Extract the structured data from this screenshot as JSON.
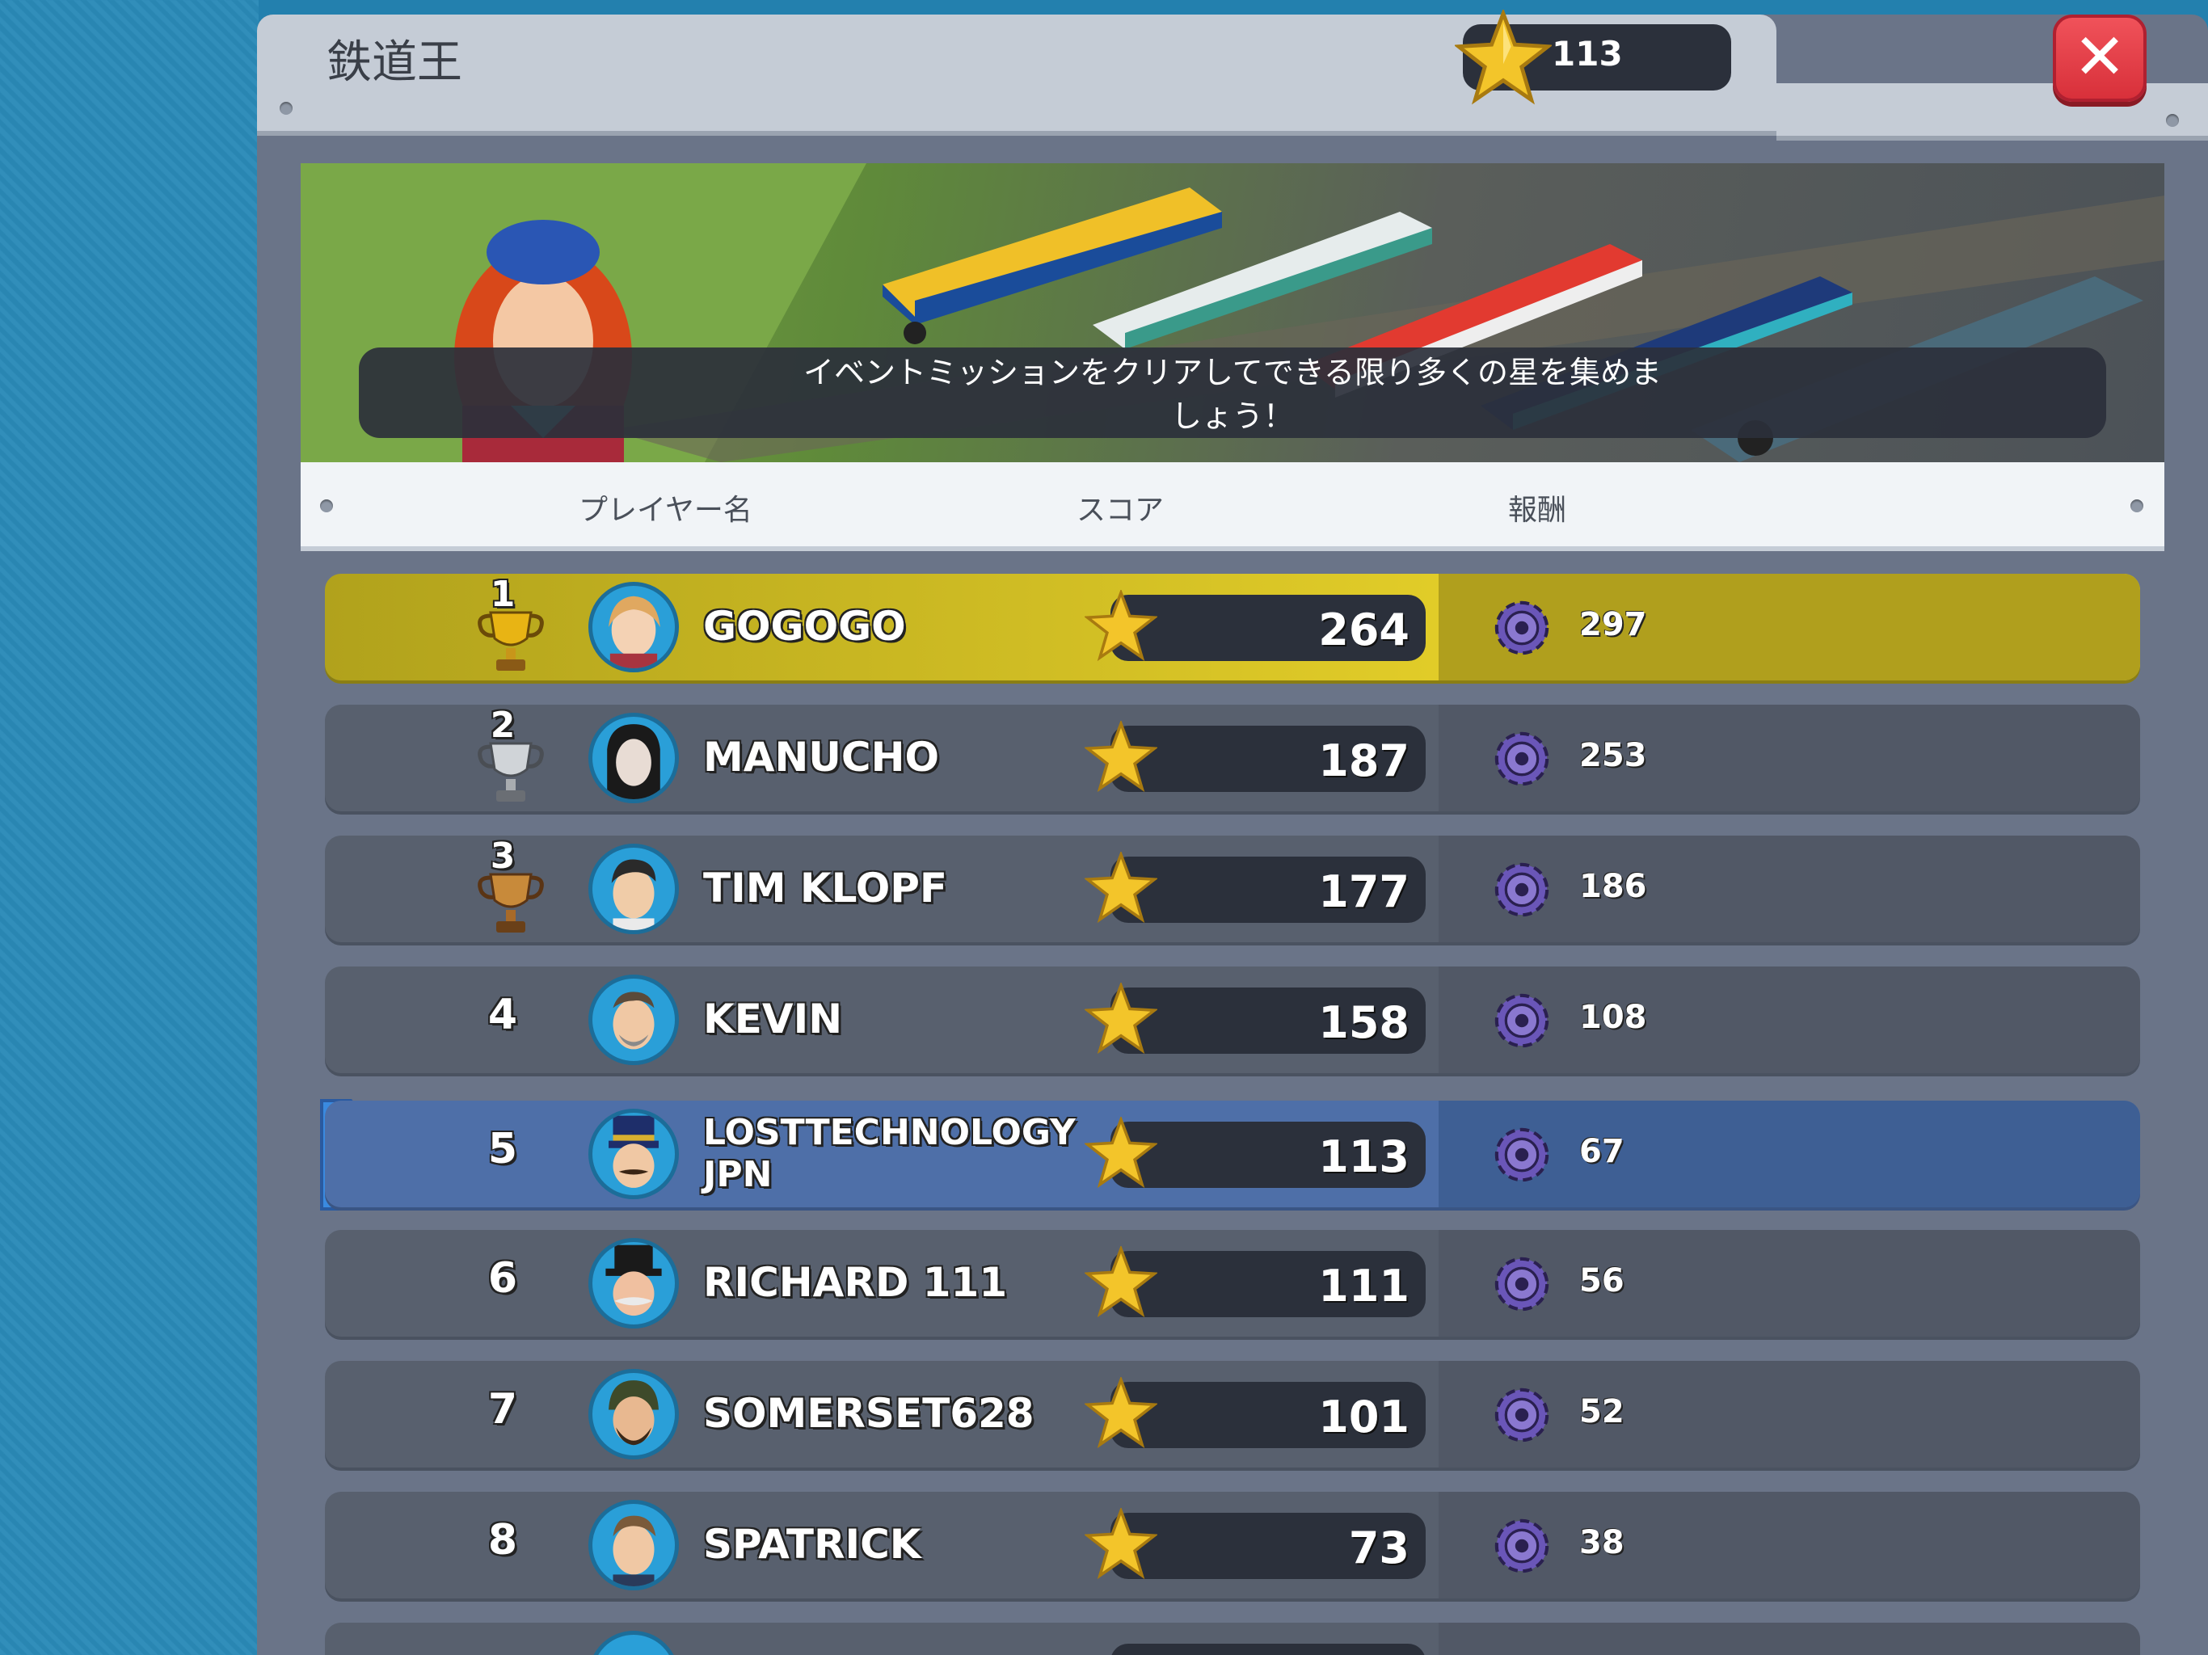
{
  "header": {
    "title": "鉄道王",
    "star_total": "113",
    "close_label": "✕"
  },
  "banner": {
    "caption_line1": "イベントミッションをクリアしてできる限り多くの星を集めま",
    "caption_line2": "しょう！"
  },
  "columns": {
    "player": "プレイヤー名",
    "score": "スコア",
    "reward": "報酬"
  },
  "rows": [
    {
      "rank": "1",
      "name": "GOGOGO",
      "score": "264",
      "reward": "297",
      "trophy": "gold-trophy-icon"
    },
    {
      "rank": "2",
      "name": "MANUCHO",
      "score": "187",
      "reward": "253",
      "trophy": "silver-trophy-icon"
    },
    {
      "rank": "3",
      "name": "TIM KLOPF",
      "score": "177",
      "reward": "186",
      "trophy": "bronze-trophy-icon"
    },
    {
      "rank": "4",
      "name": "KEVIN",
      "score": "158",
      "reward": "108"
    },
    {
      "rank": "5",
      "name_line1": "LOSTTECHNOLOGY",
      "name_line2": "JPN",
      "score": "113",
      "reward": "67",
      "is_me": true
    },
    {
      "rank": "6",
      "name": "RICHARD 111",
      "score": "111",
      "reward": "56"
    },
    {
      "rank": "7",
      "name": "SOMERSET628",
      "score": "101",
      "reward": "52"
    },
    {
      "rank": "8",
      "name": "SPATRICK",
      "score": "73",
      "reward": "38"
    }
  ],
  "colors": {
    "gold_row": "#e8d22a",
    "me_row": "#4e6fa8",
    "default_row": "#58606e",
    "close_red": "#e0404a"
  }
}
